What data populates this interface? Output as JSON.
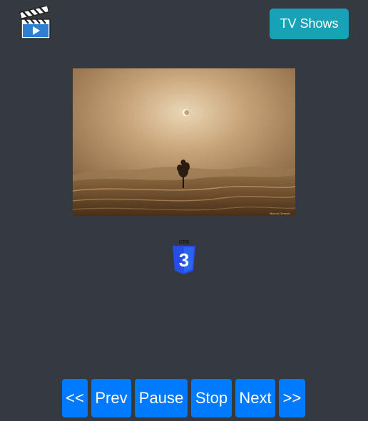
{
  "header": {
    "logo_icon": "clapperboard-play-icon",
    "tv_shows_label": "TV Shows"
  },
  "colors": {
    "page_background": "#343a40",
    "tv_shows_button": "#17a2b8",
    "control_buttons": "#007bff"
  },
  "media": {
    "image_caption": "Marcus Desseix",
    "badge_icon": "css3-shield-icon",
    "badge_text": "CSS",
    "badge_numeral": "3"
  },
  "controls": {
    "first": "<<",
    "prev": "Prev",
    "pause": "Pause",
    "stop": "Stop",
    "next": "Next",
    "last": ">>"
  }
}
